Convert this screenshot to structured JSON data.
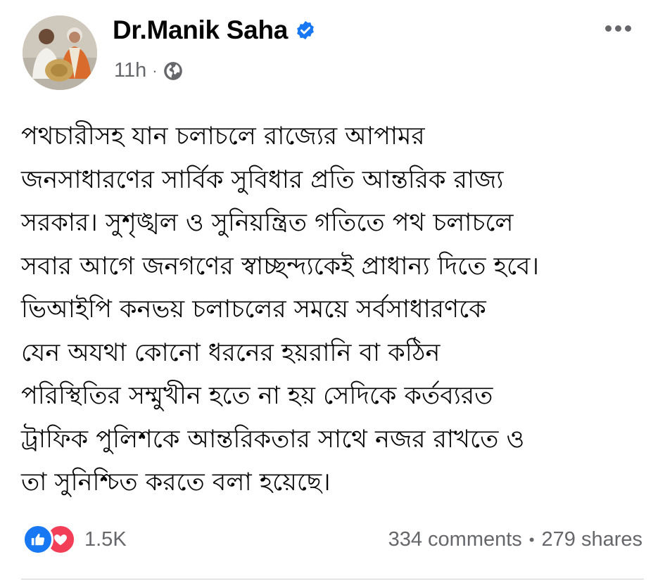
{
  "header": {
    "author_name": "Dr.Manik Saha",
    "timestamp": "11h",
    "separator": "·",
    "audience_icon": "globe-icon",
    "verified_icon": "verified-badge-icon",
    "more_icon": "more-options-icon"
  },
  "post": {
    "lines": [
      "পথচারীসহ যান চলাচলে রাজ্যের আপামর",
      "জনসাধারণের সার্বিক সুবিধার প্রতি আন্তরিক রাজ্য",
      "সরকার। সুশৃঙ্খল ও সুনিয়ন্ত্রিত গতিতে পথ চলাচলে",
      "সবার আগে জনগণের স্বাচ্ছন্দ্যকেই প্রাধান্য দিতে হবে।",
      "ভিআইপি কনভয়  চলাচলের সময়ে সর্বসাধারণকে",
      "যেন অযথা কোনো ধরনের হয়রানি বা কঠিন",
      "পরিস্থিতির সম্মুখীন  হতে না হয় সেদিকে কর্তব্যরত",
      "ট্রাফিক পুলিশকে  আন্তরিকতার সাথে নজর রাখতে ও",
      "তা সুনিশ্চিত করতে  বলা হয়েছে।"
    ]
  },
  "footer": {
    "reaction_icons": [
      "like-icon",
      "love-icon"
    ],
    "reaction_count": "1.5K",
    "comments": "334 comments",
    "separator": "•",
    "shares": "279 shares"
  },
  "colors": {
    "text": "#050505",
    "secondary": "#65676b",
    "verified_blue": "#1877f2",
    "like_blue": "#1877f2",
    "love_red": "#f33e58",
    "divider": "#ced0d4"
  }
}
